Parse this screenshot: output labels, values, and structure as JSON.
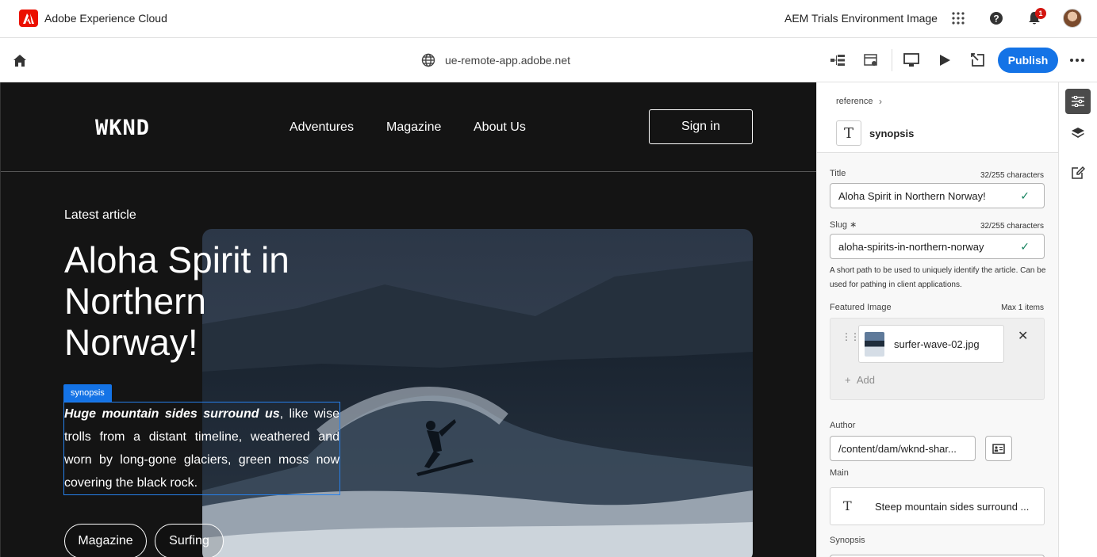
{
  "shell": {
    "app_name": "Adobe Experience Cloud",
    "env_name": "AEM Trials Environment Image",
    "notification_count": "1"
  },
  "toolbar": {
    "url": "ue-remote-app.adobe.net",
    "publish_label": "Publish"
  },
  "site": {
    "logo": "WKND",
    "nav": [
      "Adventures",
      "Magazine",
      "About Us"
    ],
    "sign_in": "Sign in",
    "latest": "Latest article",
    "headline": "Aloha Spirit in Northern Norway!",
    "synopsis_tag": "synopsis",
    "synopsis_bold": "Huge mountain sides surround us",
    "synopsis_rest": ", like wise trolls from a distant timeline, weathered and worn by long-gone glaciers, green moss now covering the black rock.",
    "tags": [
      "Magazine",
      "Surfing"
    ]
  },
  "panel": {
    "breadcrumb": "reference",
    "component_name": "synopsis",
    "title_label": "Title",
    "title_count": "32/255 characters",
    "title_value": "Aloha Spirit in Northern Norway!",
    "slug_label": "Slug ∗",
    "slug_count": "32/255 characters",
    "slug_value": "aloha-spirits-in-northern-norway",
    "slug_help": "A short path to be used to uniquely identify the article. Can be used for pathing in client applications.",
    "featured_label": "Featured Image",
    "featured_max": "Max 1 items",
    "image_name": "surfer-wave-02.jpg",
    "add_label": "Add",
    "author_label": "Author",
    "author_value": "/content/dam/wknd-shar...",
    "main_label": "Main",
    "main_value": "Steep mountain sides surround ...",
    "synopsis_label": "Synopsis"
  },
  "colors": {
    "accent": "#1473e6",
    "canvas_bg": "#141414",
    "valid": "#12805c",
    "adobe_red": "#eb1000"
  },
  "icons": [
    "adobe-logo-icon",
    "apps-grid-icon",
    "help-icon",
    "bell-icon",
    "home-icon",
    "globe-icon",
    "tree-icon",
    "settings-panel-icon",
    "desktop-icon",
    "play-icon",
    "open-external-icon",
    "more-icon",
    "properties-icon",
    "layers-icon",
    "edit-note-icon"
  ]
}
